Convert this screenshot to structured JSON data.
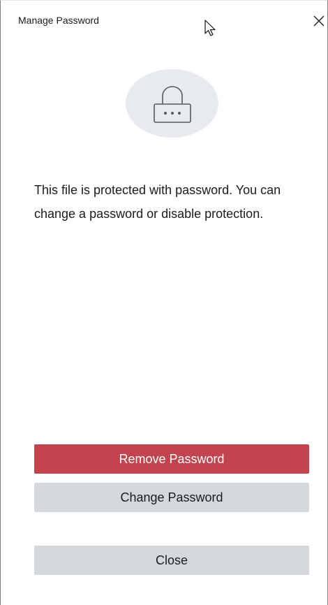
{
  "dialog": {
    "title": "Manage Password",
    "close_icon": "close-icon",
    "lock_icon": "lock-icon",
    "message": "This file is protected with password. You can change a password or disable protection."
  },
  "buttons": {
    "remove": "Remove Password",
    "change": "Change Password",
    "close": "Close"
  },
  "colors": {
    "danger": "#c1444f",
    "secondary": "#d5d9dd",
    "icon_circle": "#e7eaef"
  }
}
